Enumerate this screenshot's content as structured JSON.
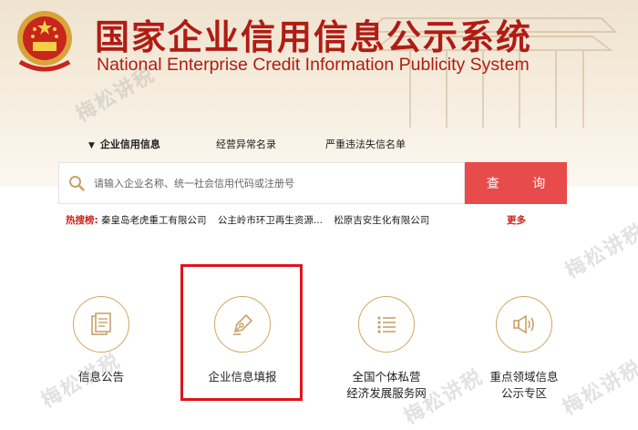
{
  "header": {
    "title_cn": "国家企业信用信息公示系统",
    "title_en": "National Enterprise Credit Information Publicity System"
  },
  "tabs": [
    {
      "label": "企业信用信息",
      "active": true
    },
    {
      "label": "经营异常名录",
      "active": false
    },
    {
      "label": "严重违法失信名单",
      "active": false
    }
  ],
  "search": {
    "placeholder": "请输入企业名称、统一社会信用代码或注册号",
    "button_label": "查 询"
  },
  "hot_search": {
    "label": "热搜榜:",
    "items": [
      "秦皇岛老虎重工有限公司",
      "公主岭市环卫再生资源...",
      "松原吉安生化有限公司"
    ],
    "more": "更多"
  },
  "cards": [
    {
      "label": "信息公告",
      "icon": "document-icon"
    },
    {
      "label": "企业信息填报",
      "icon": "pen-nib-icon"
    },
    {
      "label_line1": "全国个体私营",
      "label_line2": "经济发展服务网",
      "icon": "list-icon"
    },
    {
      "label_line1": "重点领域信息",
      "label_line2": "公示专区",
      "icon": "megaphone-icon"
    }
  ],
  "watermark": "梅松讲税",
  "colors": {
    "brand_red": "#b01c14",
    "button_red": "#e84b4b",
    "gold": "#cfa663",
    "highlight": "#e0141a"
  }
}
